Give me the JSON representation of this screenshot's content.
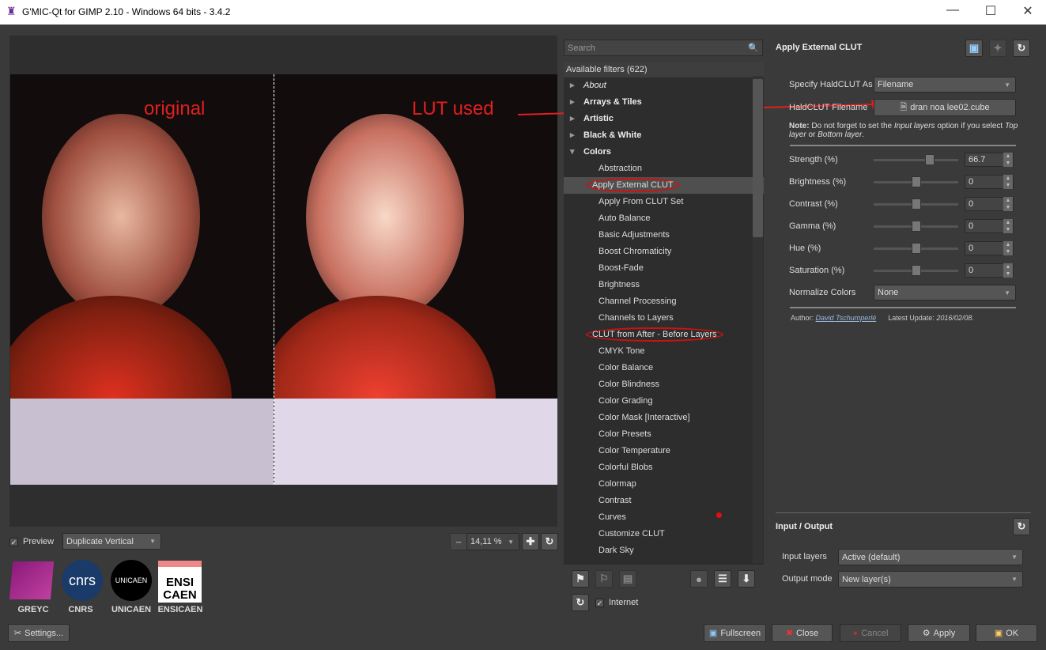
{
  "window": {
    "title": "G'MIC-Qt for GIMP 2.10 - Windows 64 bits - 3.4.2"
  },
  "annotations": {
    "left": "original",
    "right": "LUT used",
    "color": "#e02020"
  },
  "preview": {
    "checkbox_label": "Preview",
    "checked": true,
    "mode": "Duplicate Vertical",
    "zoom": "14,11 %"
  },
  "logos": [
    "GREYC",
    "CNRS",
    "UNICAEN",
    "ENSICAEN"
  ],
  "settings_label": "Settings...",
  "filters": {
    "search_placeholder": "Search",
    "header": "Available filters (622)",
    "items": [
      {
        "label": "About",
        "type": "category-italic"
      },
      {
        "label": "Arrays & Tiles",
        "type": "category"
      },
      {
        "label": "Artistic",
        "type": "category"
      },
      {
        "label": "Black & White",
        "type": "category"
      },
      {
        "label": "Colors",
        "type": "category-open"
      },
      {
        "label": "Abstraction"
      },
      {
        "label": "Apply External CLUT",
        "selected": true,
        "circled": true
      },
      {
        "label": "Apply From CLUT Set"
      },
      {
        "label": "Auto Balance"
      },
      {
        "label": "Basic Adjustments"
      },
      {
        "label": "Boost Chromaticity"
      },
      {
        "label": "Boost-Fade"
      },
      {
        "label": "Brightness"
      },
      {
        "label": "Channel Processing"
      },
      {
        "label": "Channels to Layers"
      },
      {
        "label": "CLUT from After - Before Layers",
        "circled": true
      },
      {
        "label": "CMYK Tone"
      },
      {
        "label": "Color Balance"
      },
      {
        "label": "Color Blindness"
      },
      {
        "label": "Color Grading"
      },
      {
        "label": "Color Mask [Interactive]"
      },
      {
        "label": "Color Presets"
      },
      {
        "label": "Color Temperature"
      },
      {
        "label": "Colorful Blobs"
      },
      {
        "label": "Colormap"
      },
      {
        "label": "Contrast"
      },
      {
        "label": "Curves"
      },
      {
        "label": "Customize CLUT"
      },
      {
        "label": "Dark Sky"
      }
    ]
  },
  "internet": {
    "label": "Internet",
    "checked": true
  },
  "filter_panel": {
    "title": "Apply External CLUT",
    "specify_label": "Specify HaldCLUT As",
    "specify_value": "Filename",
    "filename_label": "HaldCLUT Filename",
    "filename_value": "dran noa lee02.cube",
    "note_bold": "Note:",
    "note_1": " Do not forget to set the ",
    "note_i1": "Input layers",
    "note_2": " option if you select ",
    "note_i2": "Top layer",
    "note_3": " or ",
    "note_i3": "Bottom layer",
    "note_4": ".",
    "params": [
      {
        "label": "Strength (%)",
        "value": "66.7",
        "fraction": 0.667
      },
      {
        "label": "Brightness (%)",
        "value": "0",
        "fraction": 0.5
      },
      {
        "label": "Contrast (%)",
        "value": "0",
        "fraction": 0.5
      },
      {
        "label": "Gamma (%)",
        "value": "0",
        "fraction": 0.5
      },
      {
        "label": "Hue (%)",
        "value": "0",
        "fraction": 0.5
      },
      {
        "label": "Saturation (%)",
        "value": "0",
        "fraction": 0.5
      }
    ],
    "normalize_label": "Normalize Colors",
    "normalize_value": "None",
    "author_label": "Author:",
    "author": "David Tschumperlé",
    "update_label": "Latest Update:",
    "update": "2016/02/08."
  },
  "io": {
    "title": "Input / Output",
    "input_label": "Input layers",
    "input_value": "Active (default)",
    "output_label": "Output mode",
    "output_value": "New layer(s)"
  },
  "buttons": {
    "fullscreen": "Fullscreen",
    "close": "Close",
    "cancel": "Cancel",
    "apply": "Apply",
    "ok": "OK"
  }
}
